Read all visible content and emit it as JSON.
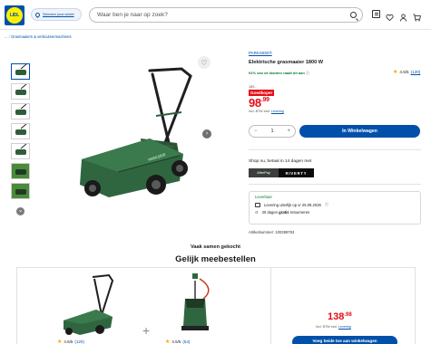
{
  "header": {
    "logo_text": "LIDL",
    "store_selector": "Selecteer jouw winkel",
    "search_placeholder": "Waar ben je naar op zoek?"
  },
  "breadcrumb": {
    "items": [
      "...",
      "Grasmaaiers & verticuteermachines"
    ]
  },
  "product": {
    "brand": "PARKSIDE®",
    "title": "Elektrische grasmaaier 1800 W",
    "rating": "4.5/5",
    "reviews": "(120)",
    "recommend": "91% van de klanten raadt dit aan",
    "old_price": "189,-",
    "deal_badge": "Goedkoper",
    "price_main": "98",
    "price_cents": ".99",
    "vat_text": "Incl. BTW excl.",
    "vat_link": "Levering",
    "quantity": "1",
    "add_button": "In Winkelwagen",
    "paylater": "Shop nu, betaal in 14 dagen met",
    "riverty_a": "AfterPay",
    "riverty_b": "RIVERTY",
    "delivery_status": "Leverbaar",
    "delivery_date": "Levering uiterlijk op vr 25.09.2026",
    "return_pre": "30 dagen",
    "return_bold": "gratis",
    "return_post": "retourneren",
    "article_number": "Artikelnummer: 100398793"
  },
  "bundle": {
    "kicker": "Vaak samen gekocht",
    "title": "Gelijk meebestellen",
    "item1_rating": "4.5/5",
    "item1_reviews": "(120)",
    "item2_rating": "4.5/5",
    "item2_reviews": "(54)",
    "total_main": "138",
    "total_cents": ".98",
    "vat_text": "Incl. BTW excl.",
    "vat_link": "Levering",
    "button": "Voeg beide toe aan winkelwagen"
  },
  "colors": {
    "brand_blue": "#0050aa",
    "price_red": "#e60a14",
    "lidl_yellow": "#fff000"
  }
}
